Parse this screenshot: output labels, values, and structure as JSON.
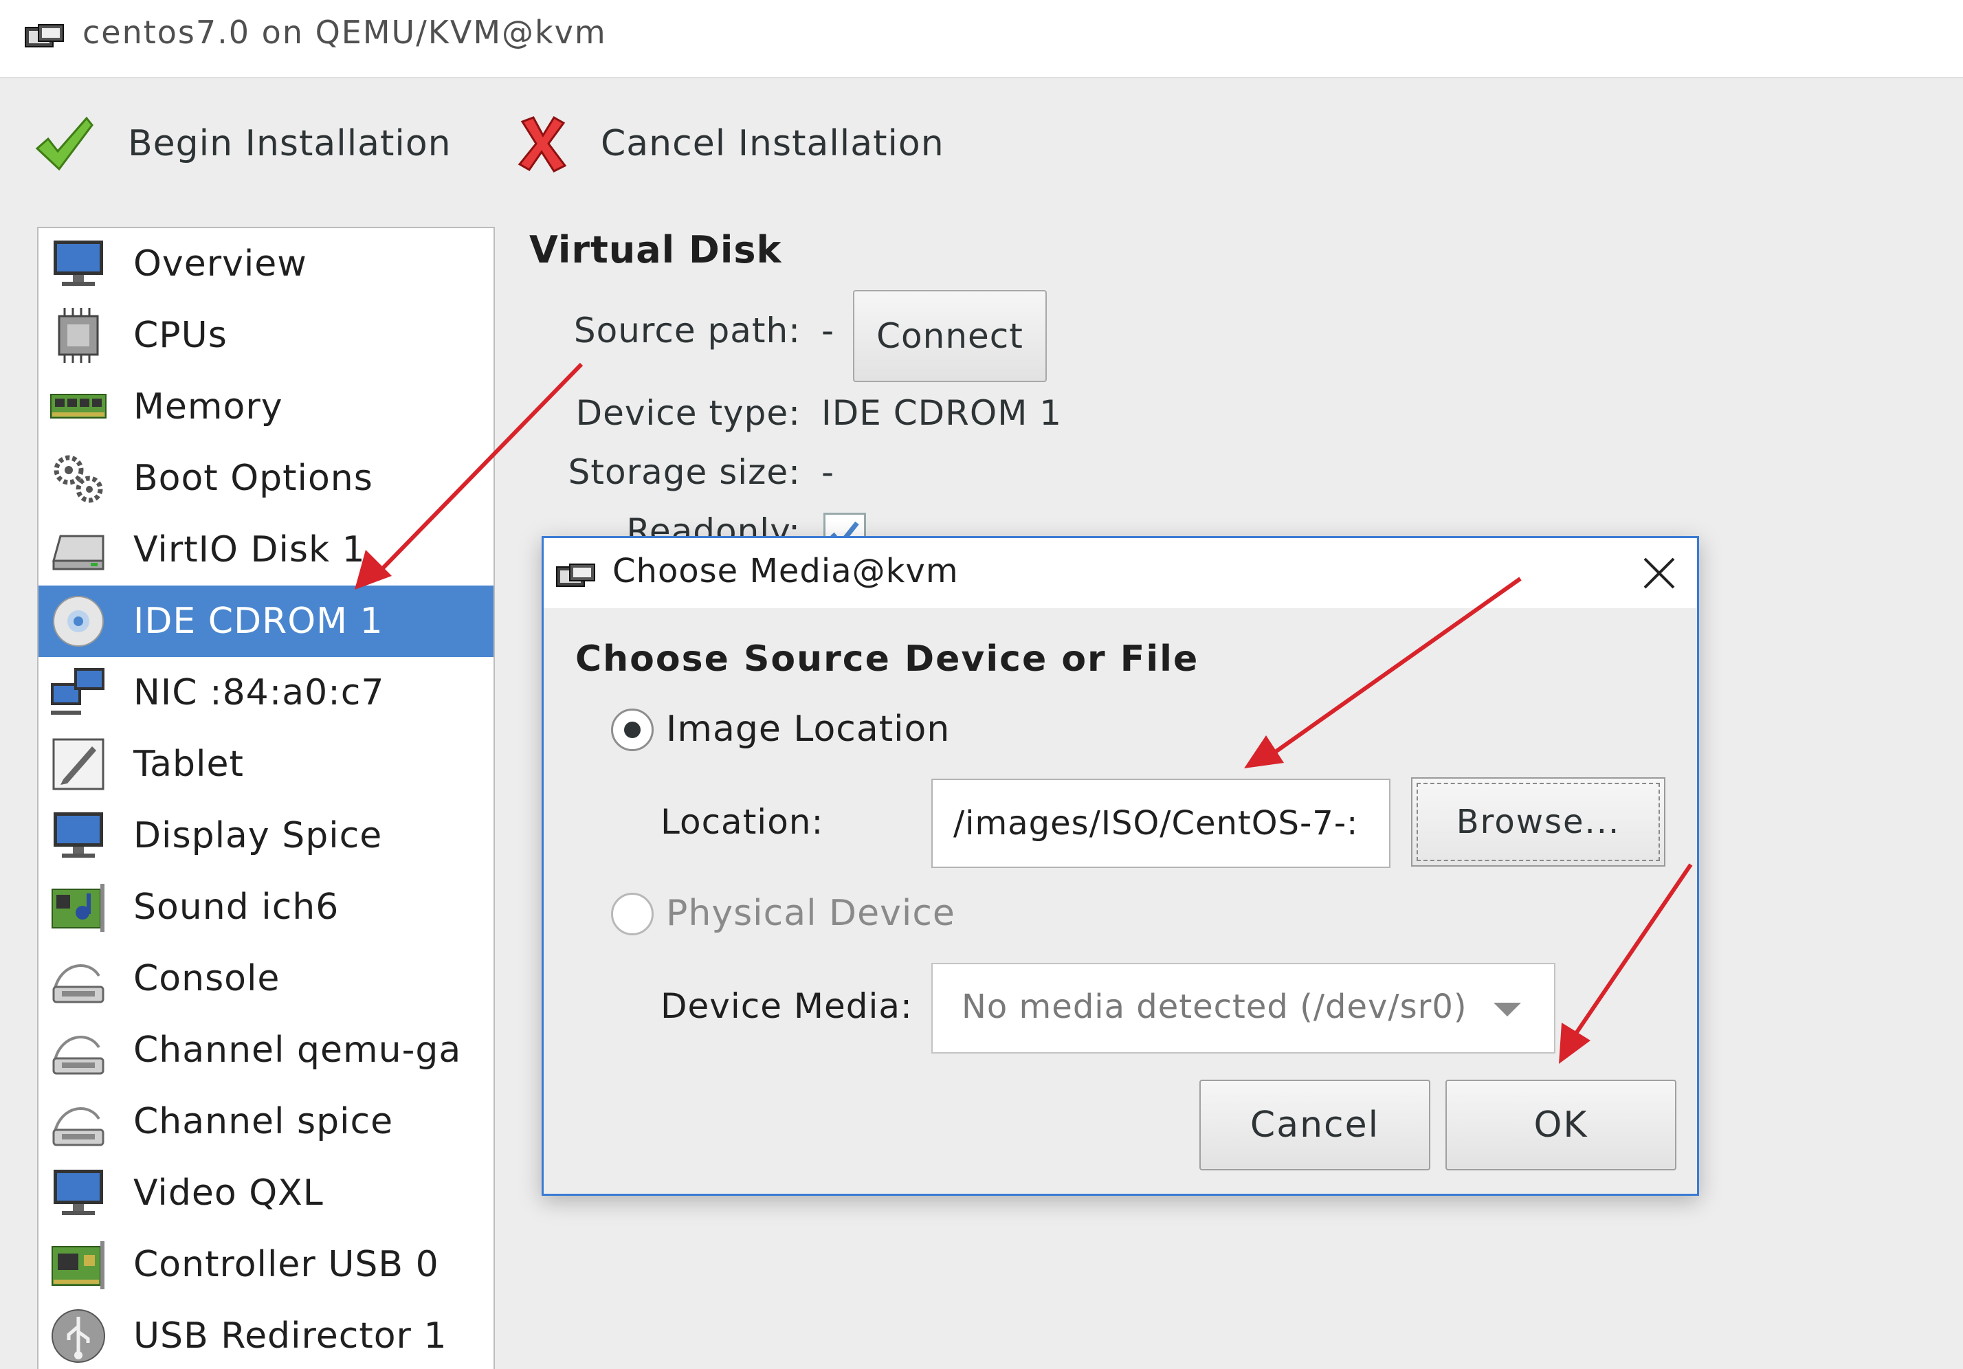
{
  "window": {
    "title": "centos7.0 on QEMU/KVM@kvm",
    "icon": "virt-manager-icon"
  },
  "toolbar": {
    "begin_label": "Begin Installation",
    "cancel_label": "Cancel Installation",
    "begin_icon": "checkmark-icon",
    "cancel_icon": "red-x-icon"
  },
  "sidebar": {
    "selected_index": 5,
    "items": [
      {
        "label": "Overview",
        "icon": "monitor-icon"
      },
      {
        "label": "CPUs",
        "icon": "cpu-icon"
      },
      {
        "label": "Memory",
        "icon": "memory-icon"
      },
      {
        "label": "Boot Options",
        "icon": "gears-icon"
      },
      {
        "label": "VirtIO Disk 1",
        "icon": "disk-icon"
      },
      {
        "label": "IDE CDROM 1",
        "icon": "cdrom-icon"
      },
      {
        "label": "NIC :84:a0:c7",
        "icon": "network-icon"
      },
      {
        "label": "Tablet",
        "icon": "tablet-icon"
      },
      {
        "label": "Display Spice",
        "icon": "monitor-icon"
      },
      {
        "label": "Sound ich6",
        "icon": "sound-card-icon"
      },
      {
        "label": "Console",
        "icon": "serial-icon"
      },
      {
        "label": "Channel qemu-ga",
        "icon": "serial-icon"
      },
      {
        "label": "Channel spice",
        "icon": "serial-icon"
      },
      {
        "label": "Video QXL",
        "icon": "monitor-icon"
      },
      {
        "label": "Controller USB 0",
        "icon": "card-icon"
      },
      {
        "label": "USB Redirector 1",
        "icon": "usb-icon"
      }
    ]
  },
  "details": {
    "heading": "Virtual Disk",
    "source_path_label": "Source path:",
    "source_path_value": "-",
    "connect_label": "Connect",
    "device_type_label": "Device type:",
    "device_type_value": "IDE CDROM 1",
    "storage_size_label": "Storage size:",
    "storage_size_value": "-",
    "readonly_label": "Readonly:",
    "readonly_checked": true
  },
  "dialog": {
    "title": "Choose Media@kvm",
    "heading": "Choose Source Device or File",
    "image_location_label": "Image Location",
    "image_location_selected": true,
    "location_label": "Location:",
    "location_value": "/images/ISO/CentOS-7-:",
    "browse_label": "Browse...",
    "physical_device_label": "Physical Device",
    "physical_device_selected": false,
    "device_media_label": "Device Media:",
    "device_media_value": "No media detected (/dev/sr0)",
    "cancel_label": "Cancel",
    "ok_label": "OK"
  },
  "colors": {
    "selection": "#4a86cf",
    "annotation_arrow": "#d8232a",
    "dialog_border": "#3a7bd5"
  }
}
